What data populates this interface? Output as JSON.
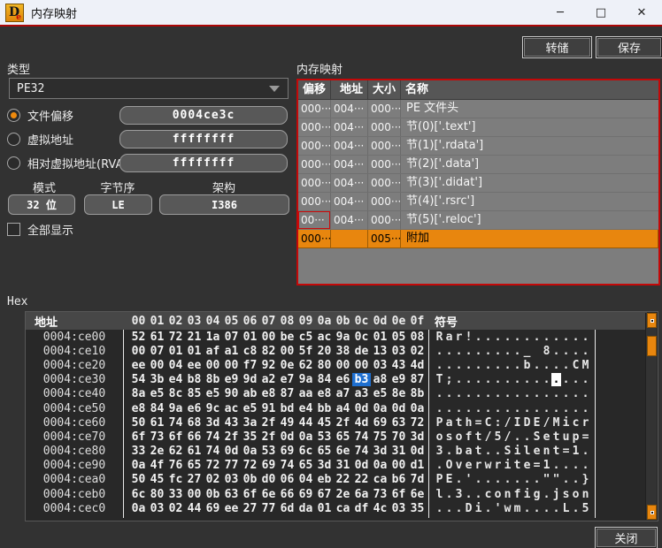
{
  "window": {
    "title": "内存映射",
    "logo": {
      "d": "D",
      "e": "e"
    },
    "controls": {
      "minimize": "─",
      "maximize": "□",
      "close": "✕"
    }
  },
  "toolbar": {
    "dump": "转储",
    "save": "保存"
  },
  "left": {
    "type_label": "类型",
    "type_value": "PE32",
    "radios": [
      {
        "label": "文件偏移",
        "value": "0004ce3c",
        "selected": true
      },
      {
        "label": "虚拟地址",
        "value": "ffffffff",
        "selected": false
      },
      {
        "label": "相对虚拟地址(RVA)",
        "value": "ffffffff",
        "selected": false
      }
    ],
    "mode_label": "模式",
    "mode_value": "32 位",
    "endian_label": "字节序",
    "endian_value": "LE",
    "arch_label": "架构",
    "arch_value": "I386",
    "show_all_label": "全部显示",
    "show_all_checked": false
  },
  "map": {
    "title": "内存映射",
    "columns": [
      "偏移",
      "地址",
      "大小",
      "名称"
    ],
    "rows": [
      {
        "offset": "000···",
        "address": "004···",
        "size": "000···",
        "name": "PE 文件头"
      },
      {
        "offset": "000···",
        "address": "004···",
        "size": "000···",
        "name": "节(0)['.text']"
      },
      {
        "offset": "000···",
        "address": "004···",
        "size": "000···",
        "name": "节(1)['.rdata']"
      },
      {
        "offset": "000···",
        "address": "004···",
        "size": "000···",
        "name": "节(2)['.data']"
      },
      {
        "offset": "000···",
        "address": "004···",
        "size": "000···",
        "name": "节(3)['.didat']"
      },
      {
        "offset": "000···",
        "address": "004···",
        "size": "000···",
        "name": "节(4)['.rsrc']"
      },
      {
        "offset": "00···",
        "address": "004···",
        "size": "000···",
        "name": "节(5)['.reloc']",
        "focus_offset": true
      },
      {
        "offset": "000···",
        "address": "",
        "size": "005···",
        "name": "附加",
        "selected": true
      }
    ]
  },
  "hex": {
    "label": "Hex",
    "address_header": "地址",
    "byte_headers": [
      "00",
      "01",
      "02",
      "03",
      "04",
      "05",
      "06",
      "07",
      "08",
      "09",
      "0a",
      "0b",
      "0c",
      "0d",
      "0e",
      "0f"
    ],
    "symbol_header": "符号",
    "rows": [
      {
        "addr": "0004:ce00",
        "bytes": [
          "52",
          "61",
          "72",
          "21",
          "1a",
          "07",
          "01",
          "00",
          "be",
          "c5",
          "ac",
          "9a",
          "0c",
          "01",
          "05",
          "08"
        ],
        "sym": "Rar!............"
      },
      {
        "addr": "0004:ce10",
        "bytes": [
          "00",
          "07",
          "01",
          "01",
          "af",
          "a1",
          "c8",
          "82",
          "00",
          "5f",
          "20",
          "38",
          "de",
          "13",
          "03",
          "02"
        ],
        "sym": "........._ 8...."
      },
      {
        "addr": "0004:ce20",
        "bytes": [
          "ee",
          "00",
          "04",
          "ee",
          "00",
          "00",
          "f7",
          "92",
          "0e",
          "62",
          "80",
          "00",
          "00",
          "03",
          "43",
          "4d"
        ],
        "sym": ".........b....CM"
      },
      {
        "addr": "0004:ce30",
        "bytes": [
          "54",
          "3b",
          "e4",
          "b8",
          "8b",
          "e9",
          "9d",
          "a2",
          "e7",
          "9a",
          "84",
          "e6",
          "b3",
          "a8",
          "e9",
          "87"
        ],
        "sym": "T;..............",
        "sel": 12
      },
      {
        "addr": "0004:ce40",
        "bytes": [
          "8a",
          "e5",
          "8c",
          "85",
          "e5",
          "90",
          "ab",
          "e8",
          "87",
          "aa",
          "e8",
          "a7",
          "a3",
          "e5",
          "8e",
          "8b"
        ],
        "sym": "................"
      },
      {
        "addr": "0004:ce50",
        "bytes": [
          "e8",
          "84",
          "9a",
          "e6",
          "9c",
          "ac",
          "e5",
          "91",
          "bd",
          "e4",
          "bb",
          "a4",
          "0d",
          "0a",
          "0d",
          "0a"
        ],
        "sym": "................"
      },
      {
        "addr": "0004:ce60",
        "bytes": [
          "50",
          "61",
          "74",
          "68",
          "3d",
          "43",
          "3a",
          "2f",
          "49",
          "44",
          "45",
          "2f",
          "4d",
          "69",
          "63",
          "72"
        ],
        "sym": "Path=C:/IDE/Micr"
      },
      {
        "addr": "0004:ce70",
        "bytes": [
          "6f",
          "73",
          "6f",
          "66",
          "74",
          "2f",
          "35",
          "2f",
          "0d",
          "0a",
          "53",
          "65",
          "74",
          "75",
          "70",
          "3d"
        ],
        "sym": "osoft/5/..Setup="
      },
      {
        "addr": "0004:ce80",
        "bytes": [
          "33",
          "2e",
          "62",
          "61",
          "74",
          "0d",
          "0a",
          "53",
          "69",
          "6c",
          "65",
          "6e",
          "74",
          "3d",
          "31",
          "0d"
        ],
        "sym": "3.bat..Silent=1."
      },
      {
        "addr": "0004:ce90",
        "bytes": [
          "0a",
          "4f",
          "76",
          "65",
          "72",
          "77",
          "72",
          "69",
          "74",
          "65",
          "3d",
          "31",
          "0d",
          "0a",
          "00",
          "d1"
        ],
        "sym": ".Overwrite=1...."
      },
      {
        "addr": "0004:cea0",
        "bytes": [
          "50",
          "45",
          "fc",
          "27",
          "02",
          "03",
          "0b",
          "d0",
          "06",
          "04",
          "eb",
          "22",
          "22",
          "ca",
          "b6",
          "7d"
        ],
        "sym": "PE.'.......\"\"..}"
      },
      {
        "addr": "0004:ceb0",
        "bytes": [
          "6c",
          "80",
          "33",
          "00",
          "0b",
          "63",
          "6f",
          "6e",
          "66",
          "69",
          "67",
          "2e",
          "6a",
          "73",
          "6f",
          "6e"
        ],
        "sym": "l.3..config.json"
      },
      {
        "addr": "0004:cec0",
        "bytes": [
          "0a",
          "03",
          "02",
          "44",
          "69",
          "ee",
          "27",
          "77",
          "6d",
          "da",
          "01",
          "ca",
          "df",
          "4c",
          "03",
          "35"
        ],
        "sym": "...Di.'wm....L.5"
      }
    ]
  },
  "footer": {
    "close": "关闭"
  },
  "colors": {
    "accent_orange": "#e8860e",
    "selection_blue": "#1e6fd0",
    "table_border_red": "#c40808",
    "titlebar_line_red": "#ad0707",
    "titlebar_bg": "#eef1f8",
    "window_bg": "#323232",
    "table_bg": "#7d7d7d",
    "hex_bg": "#282828"
  }
}
